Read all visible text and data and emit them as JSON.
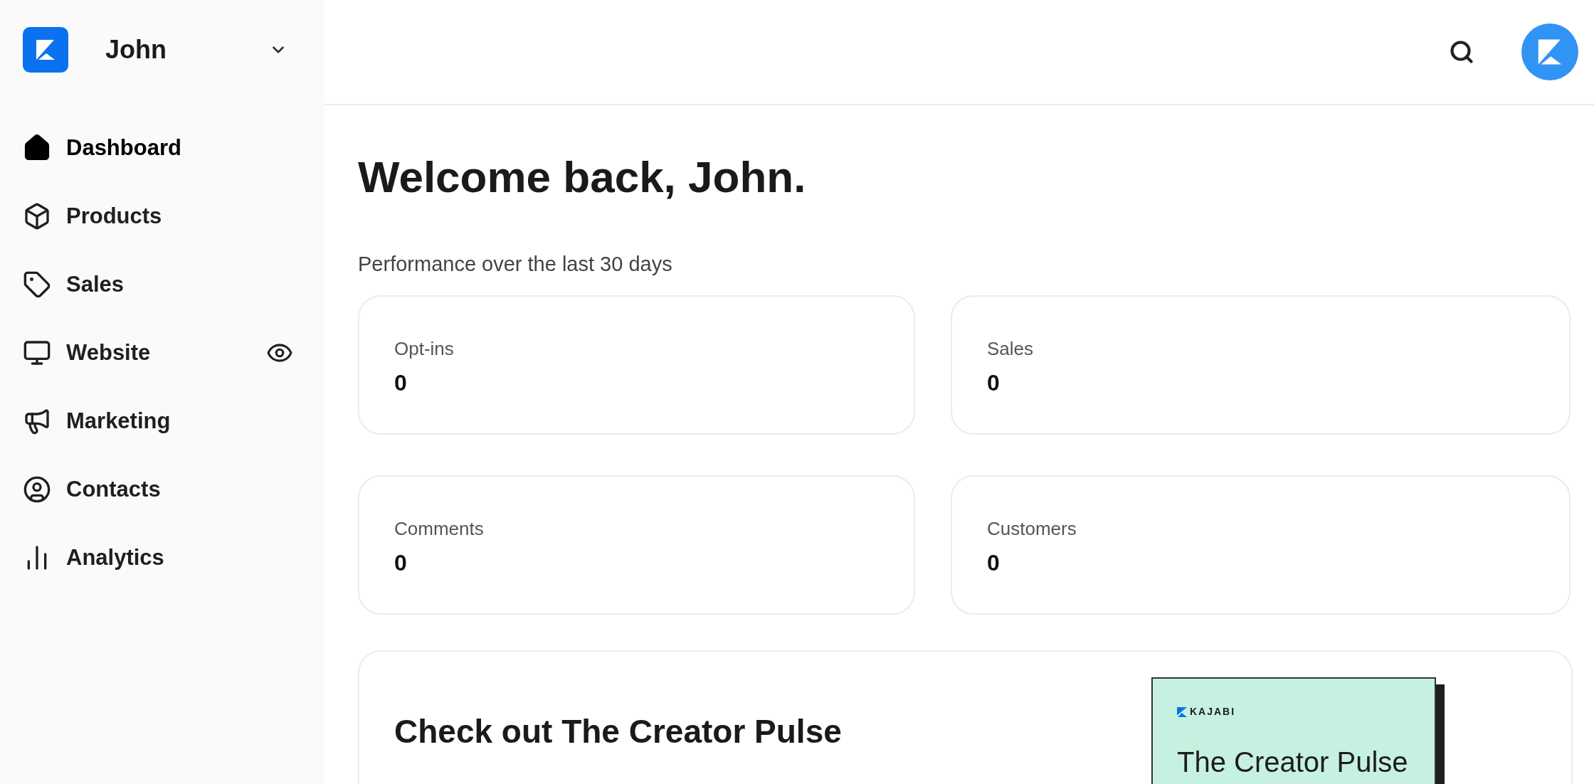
{
  "account": {
    "name": "John"
  },
  "nav": [
    {
      "label": "Dashboard",
      "selected": true
    },
    {
      "label": "Products",
      "selected": false
    },
    {
      "label": "Sales",
      "selected": false
    },
    {
      "label": "Website",
      "selected": false
    },
    {
      "label": "Marketing",
      "selected": false
    },
    {
      "label": "Contacts",
      "selected": false
    },
    {
      "label": "Analytics",
      "selected": false
    }
  ],
  "heading": "Welcome back, John.",
  "subheading": "Performance over the last 30 days",
  "stats": [
    {
      "label": "Opt-ins",
      "value": "0"
    },
    {
      "label": "Sales",
      "value": "0"
    },
    {
      "label": "Comments",
      "value": "0"
    },
    {
      "label": "Customers",
      "value": "0"
    }
  ],
  "promo": {
    "title": "Check out The Creator Pulse",
    "cover": {
      "brand": "KAJABI",
      "title": "The Creator Pulse"
    }
  }
}
